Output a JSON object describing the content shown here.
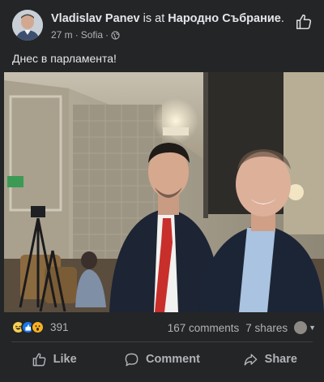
{
  "post": {
    "author": "Vladislav Panev",
    "at_text": " is at ",
    "location": "Народно Събрание",
    "period": ".",
    "time": "27 m",
    "separator": "·",
    "place": "Sofia",
    "separator2": "·",
    "privacy_icon": "globe-icon",
    "text": "Днес в парламента!"
  },
  "stats": {
    "reaction_icons": [
      "haha-icon",
      "like-icon",
      "wow-icon"
    ],
    "reaction_count": "391",
    "comments": "167 comments",
    "shares": "7 shares"
  },
  "actions": {
    "like": "Like",
    "comment": "Comment",
    "share": "Share"
  },
  "colors": {
    "background": "#242526",
    "text_primary": "#e4e6eb",
    "text_secondary": "#b0b3b8",
    "like_blue": "#1877f2"
  }
}
